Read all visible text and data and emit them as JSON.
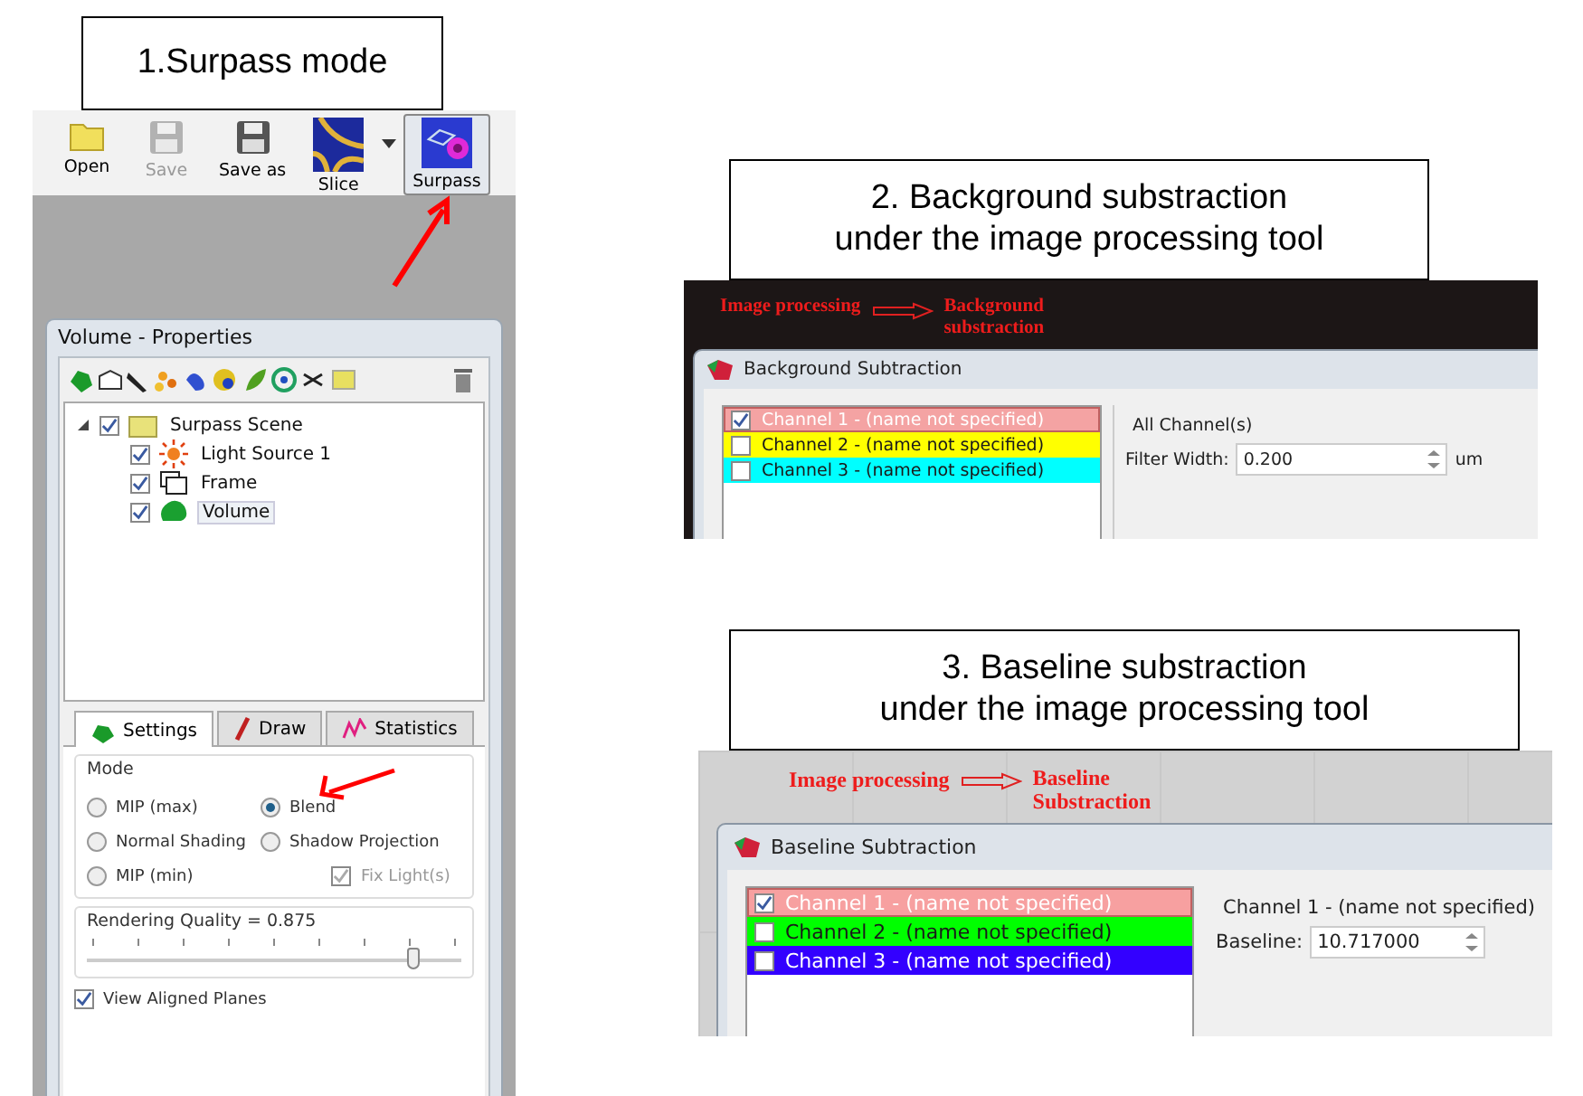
{
  "surpass": {
    "caption": "1.Surpass mode",
    "toolbar": [
      {
        "kind": "open",
        "label": "Open",
        "disabled": false,
        "selected": false
      },
      {
        "kind": "save",
        "label": "Save",
        "disabled": true,
        "selected": false
      },
      {
        "kind": "save",
        "label": "Save as",
        "disabled": false,
        "selected": false
      },
      {
        "kind": "slice",
        "label": "Slice",
        "disabled": false,
        "selected": false
      },
      {
        "kind": "surpass",
        "label": "Surpass",
        "disabled": false,
        "selected": true
      }
    ],
    "properties": {
      "title": "Volume - Properties",
      "tree": [
        {
          "label": "Surpass Scene",
          "kind": "folder",
          "checked": true,
          "expanded": true,
          "selected": false,
          "children": [
            {
              "label": "Light Source 1",
              "kind": "light",
              "checked": true,
              "selected": false
            },
            {
              "label": "Frame",
              "kind": "frame",
              "checked": true,
              "selected": false
            },
            {
              "label": "Volume",
              "kind": "volume",
              "checked": true,
              "selected": true
            }
          ]
        }
      ],
      "tabs": [
        {
          "label": "Settings",
          "kind": "settings",
          "selected": true
        },
        {
          "label": "Draw",
          "kind": "draw",
          "selected": false
        },
        {
          "label": "Statistics",
          "kind": "statistics",
          "selected": false
        }
      ],
      "mode_group": "Mode",
      "modes": [
        {
          "label": "MIP (max)",
          "selected": false
        },
        {
          "label": "Blend",
          "selected": true
        },
        {
          "label": "Normal Shading",
          "selected": false
        },
        {
          "label": "Shadow Projection",
          "selected": false
        },
        {
          "label": "MIP (min)",
          "selected": false
        }
      ],
      "fix_light": {
        "label": "Fix Light(s)",
        "checked": true,
        "disabled": true
      },
      "quality": {
        "label": "Rendering Quality = 0.875",
        "level": 0.875
      },
      "view_aligned": {
        "label": "View Aligned Planes",
        "checked": true
      }
    }
  },
  "background": {
    "caption": "2. Background substraction\nunder the image processing tool",
    "annotation": {
      "from": "Image processing",
      "to": "Background\nsubstraction"
    },
    "dialog": {
      "title": "Background Subtraction",
      "channels": [
        {
          "label": "Channel 1 - (name not specified)",
          "checked": true,
          "selected": true,
          "color": "#f4a3a3"
        },
        {
          "label": "Channel 2 - (name not specified)",
          "checked": false,
          "selected": false,
          "color": "#ffff00"
        },
        {
          "label": "Channel 3 - (name not specified)",
          "checked": false,
          "selected": false,
          "color": "#00ffff"
        }
      ],
      "group": "All Channel(s)",
      "field_label": "Filter Width:",
      "value": "0.200",
      "unit": "um"
    }
  },
  "baseline": {
    "caption": "3. Baseline substraction\nunder the image processing tool",
    "annotation": {
      "from": "Image processing",
      "to": "Baseline\nSubstraction"
    },
    "dialog": {
      "title": "Baseline Subtraction",
      "channels": [
        {
          "label": "Channel 1 - (name not specified)",
          "checked": true,
          "selected": true,
          "color": "#f7a0a0"
        },
        {
          "label": "Channel 2 - (name not specified)",
          "checked": false,
          "selected": false,
          "color": "#00ff00"
        },
        {
          "label": "Channel 3 - (name not specified)",
          "checked": false,
          "selected": false,
          "color": "#3300ff"
        }
      ],
      "group": "Channel 1 - (name not specified)",
      "field_label": "Baseline:",
      "value": "10.717000"
    }
  }
}
